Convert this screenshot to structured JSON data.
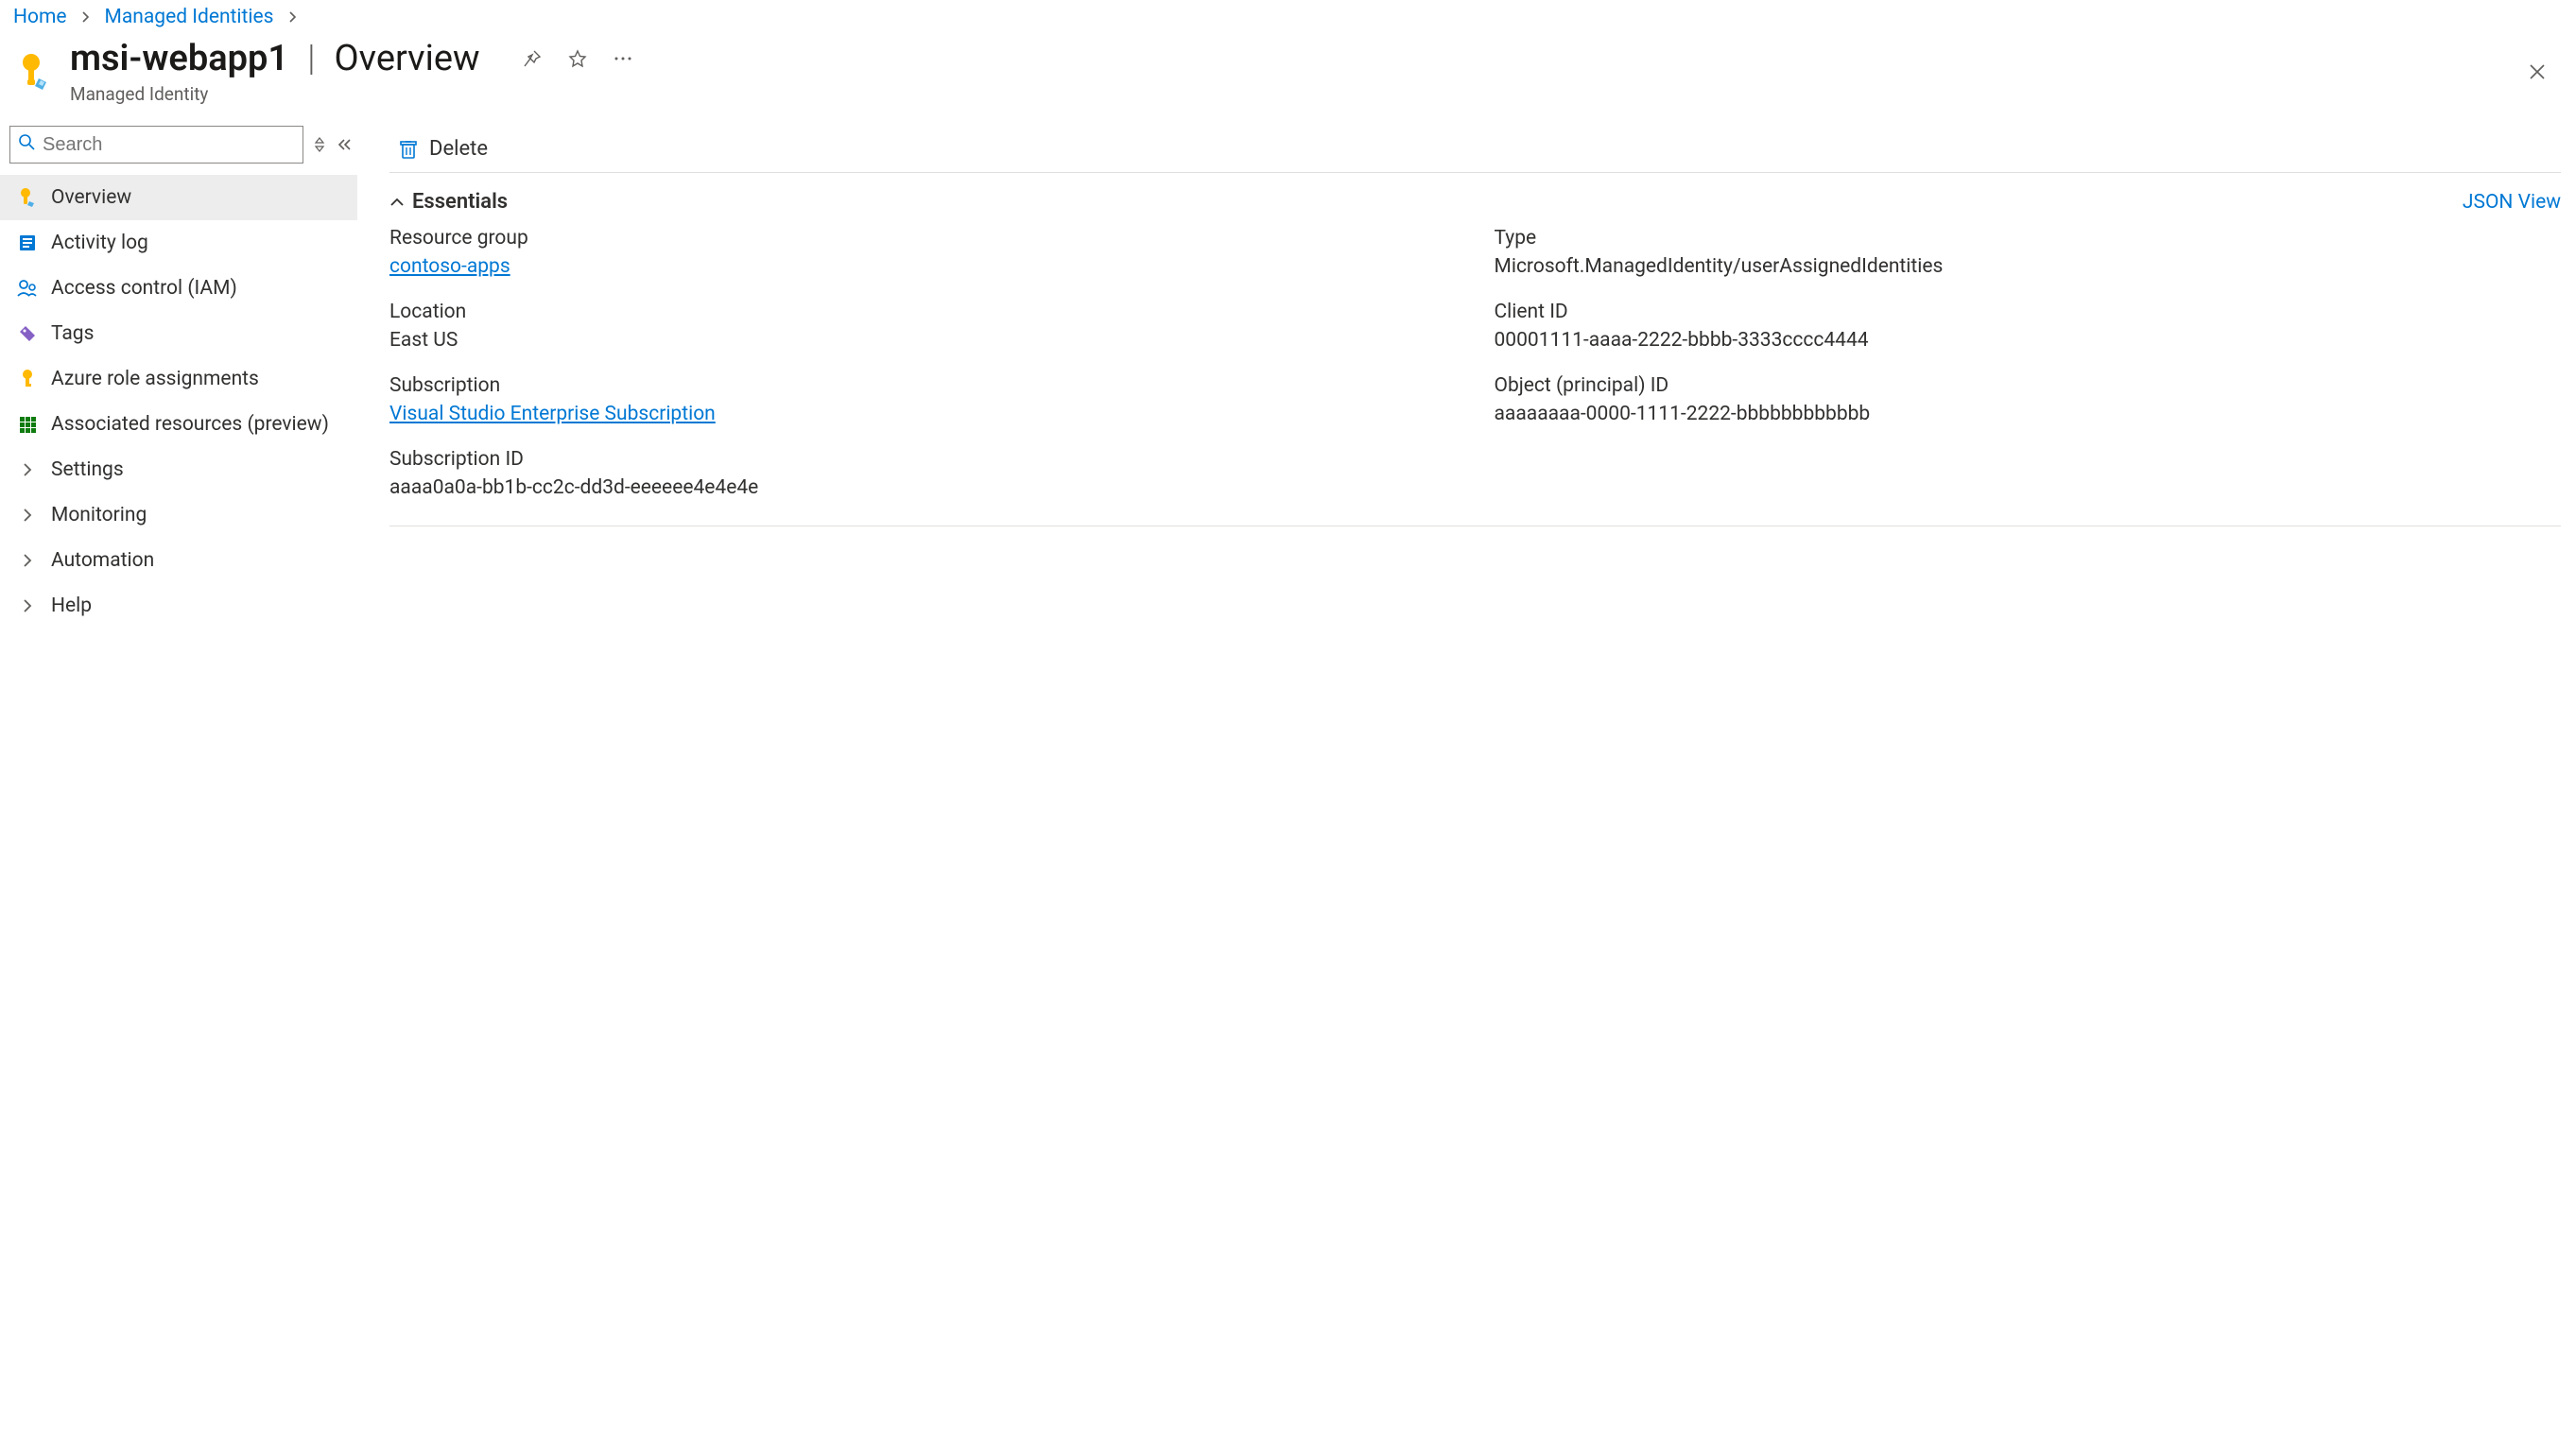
{
  "breadcrumb": {
    "home": "Home",
    "managed_identities": "Managed Identities"
  },
  "header": {
    "resource_name": "msi-webapp1",
    "page_title": "Overview",
    "subtitle": "Managed Identity"
  },
  "sidebar": {
    "search": {
      "placeholder": "Search"
    },
    "items": {
      "overview": "Overview",
      "activity_log": "Activity log",
      "access_control": "Access control (IAM)",
      "tags": "Tags",
      "role_assignments": "Azure role assignments",
      "associated_resources": "Associated resources (preview)",
      "settings": "Settings",
      "monitoring": "Monitoring",
      "automation": "Automation",
      "help": "Help"
    }
  },
  "commandbar": {
    "delete": "Delete"
  },
  "essentials": {
    "title": "Essentials",
    "json_view": "JSON View",
    "resource_group_label": "Resource group",
    "resource_group_value": "contoso-apps",
    "location_label": "Location",
    "location_value": "East US",
    "subscription_label": "Subscription",
    "subscription_value": "Visual Studio Enterprise Subscription",
    "subscription_id_label": "Subscription ID",
    "subscription_id_value": "aaaa0a0a-bb1b-cc2c-dd3d-eeeeee4e4e4e",
    "type_label": "Type",
    "type_value": "Microsoft.ManagedIdentity/userAssignedIdentities",
    "client_id_label": "Client ID",
    "client_id_value": "00001111-aaaa-2222-bbbb-3333cccc4444",
    "object_id_label": "Object (principal) ID",
    "object_id_value": "aaaaaaaa-0000-1111-2222-bbbbbbbbbbbb"
  }
}
